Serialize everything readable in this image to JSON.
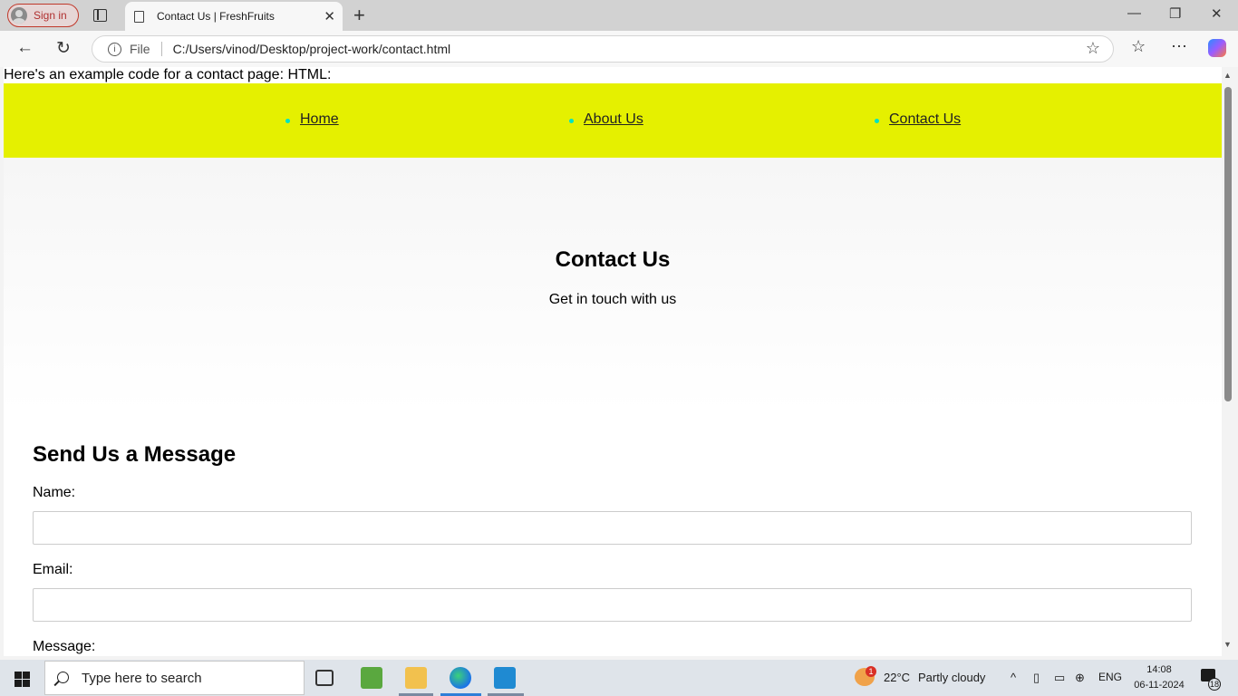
{
  "browser": {
    "signin_label": "Sign in",
    "tab_title": "Contact Us | FreshFruits",
    "address_prefix": "File",
    "address_url": "C:/Users/vinod/Desktop/project-work/contact.html"
  },
  "page": {
    "intro_text": "Here's an example code for a contact page: HTML:",
    "nav": [
      {
        "label": "Home"
      },
      {
        "label": "About Us"
      },
      {
        "label": "Contact Us"
      }
    ],
    "hero": {
      "title": "Contact Us",
      "subtitle": "Get in touch with us"
    },
    "form": {
      "title": "Send Us a Message",
      "name_label": "Name:",
      "email_label": "Email:",
      "message_label": "Message:",
      "name_value": "",
      "email_value": ""
    }
  },
  "taskbar": {
    "search_placeholder": "Type here to search",
    "weather_badge": "1",
    "weather_temp": "22°C",
    "weather_desc": "Partly cloudy",
    "language": "ENG",
    "time": "14:08",
    "date": "06-11-2024",
    "notification_count": "18"
  },
  "colors": {
    "nav_background": "#e5f000",
    "nav_bullet": "#00e3c4"
  }
}
